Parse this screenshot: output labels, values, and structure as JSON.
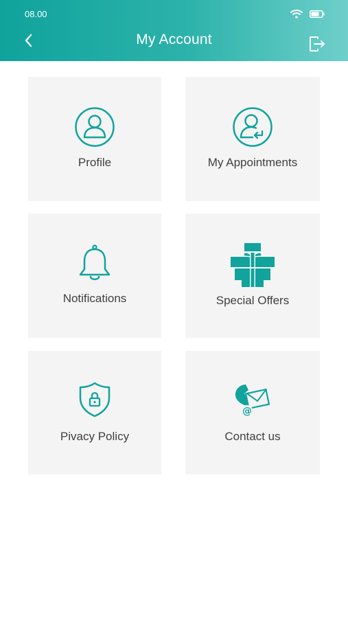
{
  "status_bar": {
    "time": "08.00"
  },
  "header": {
    "title": "My Account"
  },
  "colors": {
    "accent": "#11a39c",
    "tile_bg": "#f4f4f4",
    "label": "#3f3f3f"
  },
  "tiles": [
    {
      "label": "Profile",
      "icon": "profile-icon"
    },
    {
      "label": "My Appointments",
      "icon": "appointments-icon"
    },
    {
      "label": "Notifications",
      "icon": "bell-icon"
    },
    {
      "label": "Special Offers",
      "icon": "gift-icon"
    },
    {
      "label": "Pivacy Policy",
      "icon": "shield-lock-icon"
    },
    {
      "label": "Contact us",
      "icon": "phone-mail-icon"
    }
  ]
}
